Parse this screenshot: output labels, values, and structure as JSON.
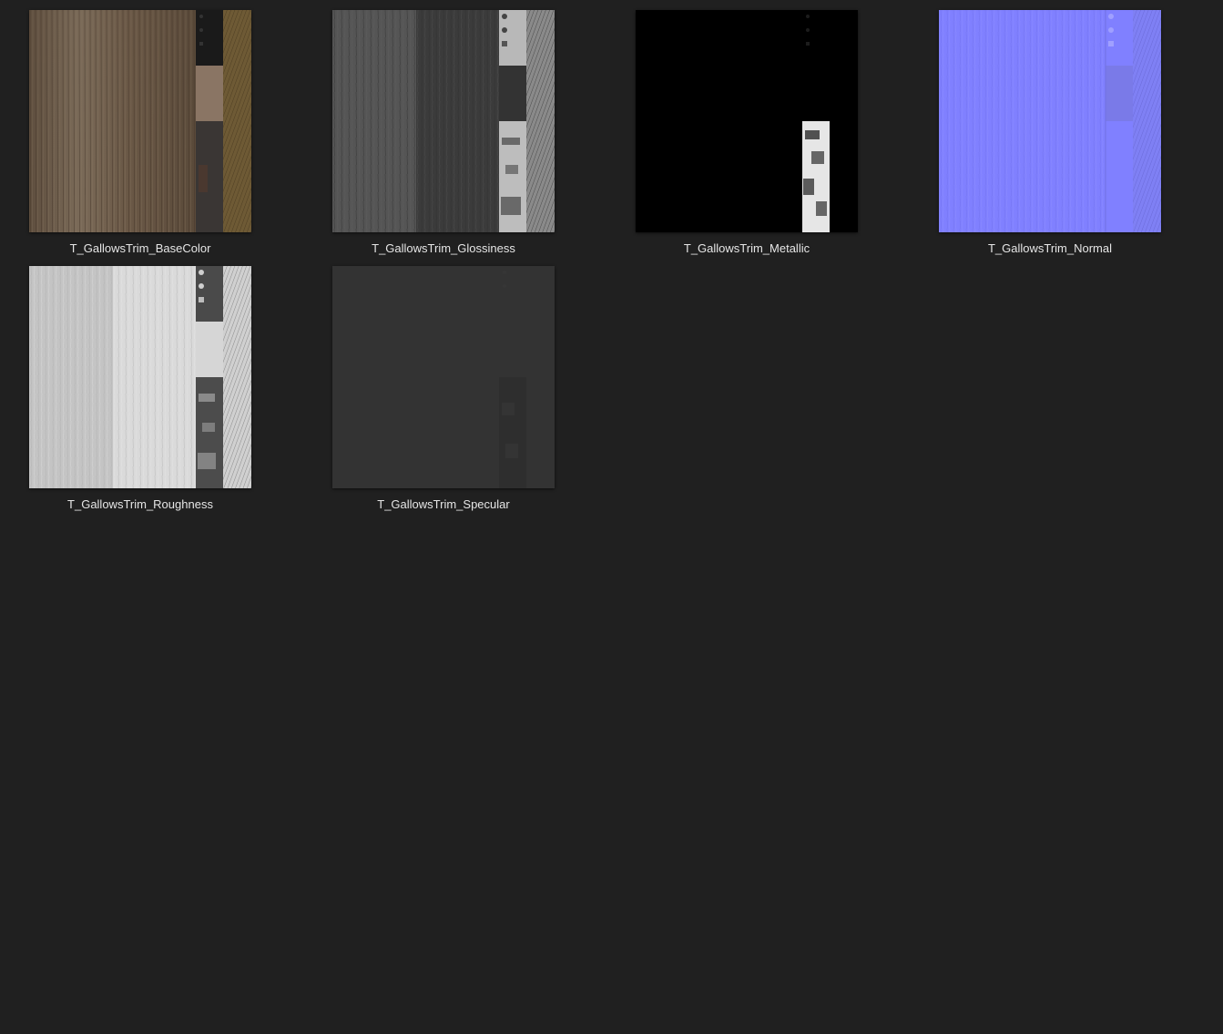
{
  "files": [
    {
      "name": "T_GallowsTrim_BaseColor",
      "map_type": "basecolor"
    },
    {
      "name": "T_GallowsTrim_Glossiness",
      "map_type": "glossiness"
    },
    {
      "name": "T_GallowsTrim_Metallic",
      "map_type": "metallic"
    },
    {
      "name": "T_GallowsTrim_Normal",
      "map_type": "normal"
    },
    {
      "name": "T_GallowsTrim_Roughness",
      "map_type": "roughness"
    },
    {
      "name": "T_GallowsTrim_Specular",
      "map_type": "specular"
    }
  ],
  "colors": {
    "background": "#202020",
    "caption_text": "#e6e6e6",
    "normal_map_base": "#8080ff",
    "basecolor_wood": "#6b5a48",
    "basecolor_trim": "#6e5a35"
  }
}
